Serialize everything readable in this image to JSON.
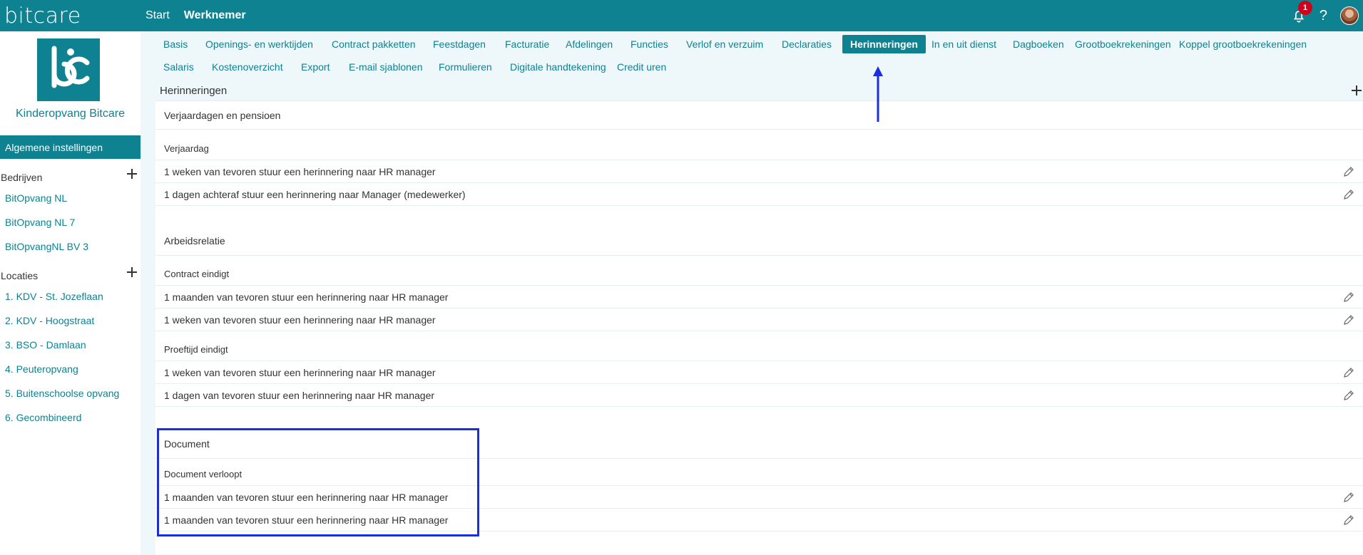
{
  "topbar": {
    "logo": "bitcare",
    "nav": [
      "Start",
      "Werknemer"
    ],
    "notification_count": "1",
    "help": "?"
  },
  "sidebar": {
    "org_name": "Kinderopvang Bitcare",
    "section_header": "Algemene instellingen",
    "companies_title": "Bedrijven",
    "companies": [
      "BitOpvang NL",
      "BitOpvang NL 7",
      "BitOpvangNL BV 3"
    ],
    "locations_title": "Locaties",
    "locations": [
      "1. KDV - St. Jozeflaan",
      "2. KDV - Hoogstraat",
      "3. BSO - Damlaan",
      "4. Peuteropvang",
      "5. Buitenschoolse opvang",
      "6. Gecombineerd"
    ]
  },
  "tabs": {
    "row1": [
      "Basis",
      "Openings- en werktijden",
      "Contract pakketten",
      "Feestdagen",
      "Facturatie",
      "Afdelingen",
      "Functies",
      "Verlof en verzuim",
      "Declaraties",
      "Herinneringen",
      "In en uit dienst",
      "Dagboeken",
      "Grootboekrekeningen",
      "Koppel grootboekrekeningen"
    ],
    "row2": [
      "Salaris",
      "Kostenoverzicht",
      "Export",
      "E-mail sjablonen",
      "Formulieren",
      "Digitale handtekening",
      "Credit uren"
    ],
    "active": "Herinneringen"
  },
  "content": {
    "title": "Herinneringen",
    "groups": [
      {
        "title": "Verjaardagen en pensioen",
        "subsections": [
          {
            "title": "Verjaardag",
            "items": [
              "1 weken van tevoren stuur een herinnering naar HR manager",
              "1 dagen achteraf stuur een herinnering naar Manager (medewerker)"
            ]
          }
        ]
      },
      {
        "title": "Arbeidsrelatie",
        "subsections": [
          {
            "title": "Contract eindigt",
            "items": [
              "1 maanden van tevoren stuur een herinnering naar HR manager",
              "1 weken van tevoren stuur een herinnering naar HR manager"
            ]
          },
          {
            "title": "Proeftijd eindigt",
            "items": [
              "1 weken van tevoren stuur een herinnering naar HR manager",
              "1 dagen van tevoren stuur een herinnering naar HR manager"
            ]
          }
        ]
      },
      {
        "title": "Document",
        "subsections": [
          {
            "title": "Document verloopt",
            "items": [
              "1 maanden van tevoren stuur een herinnering naar HR manager",
              "1 maanden van tevoren stuur een herinnering naar HR manager"
            ]
          }
        ]
      }
    ]
  },
  "colors": {
    "brand": "#0e8291",
    "badge": "#d0021b",
    "annotation": "#1a2ee0"
  }
}
